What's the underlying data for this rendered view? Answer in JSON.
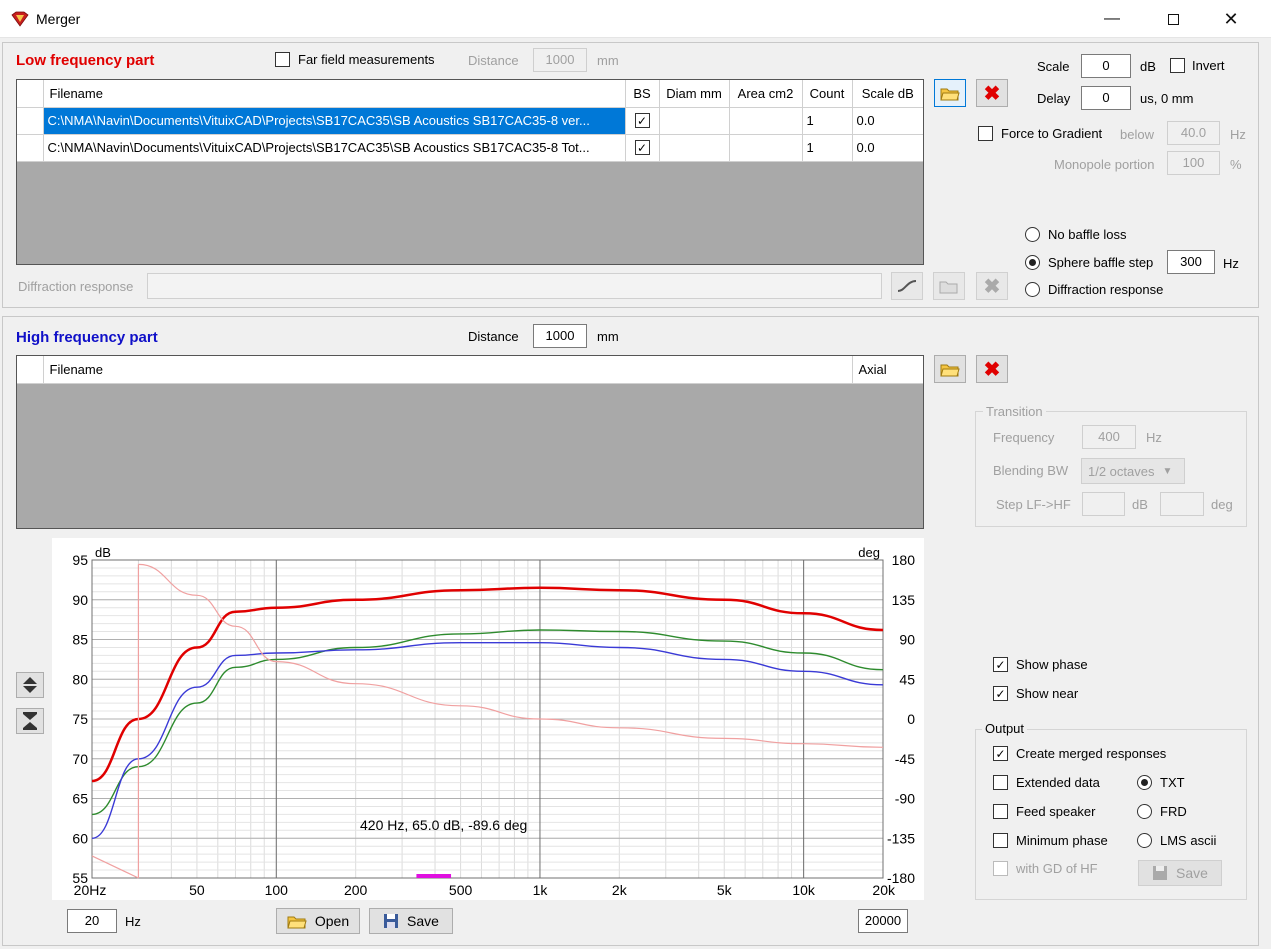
{
  "window": {
    "title": "Merger"
  },
  "lf": {
    "title": "Low frequency part",
    "far_field_label": "Far field measurements",
    "far_field_checked": false,
    "distance_label": "Distance",
    "distance_value": "1000",
    "distance_unit": "mm",
    "columns": [
      "Filename",
      "BS",
      "Diam mm",
      "Area cm2",
      "Count",
      "Scale dB"
    ],
    "rows": [
      {
        "filename": "C:\\NMA\\Navin\\Documents\\VituixCAD\\Projects\\SB17CAC35\\SB Acoustics SB17CAC35-8 ver...",
        "bs": true,
        "diam": "",
        "area": "",
        "count": "1",
        "scale": "0.0"
      },
      {
        "filename": "C:\\NMA\\Navin\\Documents\\VituixCAD\\Projects\\SB17CAC35\\SB Acoustics SB17CAC35-8 Tot...",
        "bs": true,
        "diam": "",
        "area": "",
        "count": "1",
        "scale": "0.0"
      }
    ],
    "diffraction_label": "Diffraction response",
    "scale_label": "Scale",
    "scale_value": "0",
    "scale_unit": "dB",
    "invert_label": "Invert",
    "delay_label": "Delay",
    "delay_value": "0",
    "delay_unit": "us,  0 mm",
    "force_gradient_label": "Force to Gradient",
    "below_label": "below",
    "below_value": "40.0",
    "below_unit": "Hz",
    "monopole_label": "Monopole portion",
    "monopole_value": "100",
    "monopole_unit": "%",
    "baffle_options": [
      "No baffle loss",
      "Sphere baffle step",
      "Diffraction response"
    ],
    "baffle_selected": 1,
    "baffle_value": "300",
    "baffle_unit": "Hz"
  },
  "hf": {
    "title": "High frequency part",
    "distance_label": "Distance",
    "distance_value": "1000",
    "distance_unit": "mm",
    "columns": [
      "Filename",
      "Axial"
    ],
    "transition": {
      "title": "Transition",
      "frequency_label": "Frequency",
      "frequency_value": "400",
      "frequency_unit": "Hz",
      "bw_label": "Blending BW",
      "bw_value": "1/2 octaves",
      "step_label": "Step LF->HF",
      "db_unit": "dB",
      "deg_unit": "deg"
    }
  },
  "chart_data": {
    "type": "line",
    "ylabel_left": "dB",
    "ylabel_right": "deg",
    "x_scale": "log",
    "xlim": [
      20,
      20000
    ],
    "ylim_left": [
      55,
      95
    ],
    "ylim_right": [
      -180,
      180
    ],
    "x_tick_labels": [
      "20Hz",
      "50",
      "100",
      "200",
      "500",
      "1k",
      "2k",
      "5k",
      "10k",
      "20k"
    ],
    "x_tick_values": [
      20,
      50,
      100,
      200,
      500,
      1000,
      2000,
      5000,
      10000,
      20000
    ],
    "y_ticks_left": [
      95,
      90,
      85,
      80,
      75,
      70,
      65,
      60,
      55
    ],
    "y_ticks_right": [
      180,
      135,
      90,
      45,
      0,
      -45,
      -90,
      -135,
      -180
    ],
    "grid": true,
    "cursor_readout": "420 Hz, 65.0 dB, -89.6 deg",
    "series": [
      {
        "color": "#e00000",
        "axis": "left",
        "x": [
          20,
          30,
          50,
          70,
          100,
          200,
          500,
          1000,
          2000,
          5000,
          10000,
          20000
        ],
        "y": [
          67.2,
          75,
          84,
          88.5,
          89,
          90,
          91.2,
          91.5,
          91.2,
          90,
          88.3,
          86.2
        ]
      },
      {
        "color": "#2e8b2e",
        "axis": "left",
        "x": [
          20,
          30,
          50,
          70,
          100,
          200,
          500,
          1000,
          2000,
          5000,
          10000,
          20000
        ],
        "y": [
          63,
          69,
          77,
          81.5,
          82.5,
          84,
          85.7,
          86.2,
          86,
          84.8,
          83.3,
          81.2
        ]
      },
      {
        "color": "#3a3ad6",
        "axis": "left",
        "x": [
          20,
          30,
          50,
          70,
          100,
          200,
          500,
          1000,
          2000,
          5000,
          10000,
          20000
        ],
        "y": [
          60,
          70,
          79,
          83,
          83.3,
          83.7,
          84.6,
          84.6,
          84,
          82.5,
          81,
          79.3
        ]
      },
      {
        "color": "#f0a0a0",
        "axis": "right",
        "x": [
          30,
          50,
          70,
          100,
          200,
          500,
          1000,
          2000,
          5000,
          10000,
          20000
        ],
        "y": [
          175,
          140,
          105,
          65,
          40,
          15,
          0,
          -10,
          -22,
          -28,
          -32
        ]
      }
    ],
    "near_phase_stub": {
      "color": "#f0a0a0",
      "x": [
        20,
        30
      ],
      "y": [
        -155,
        -180
      ]
    }
  },
  "chart_controls": {
    "min_value": "20",
    "min_unit": "Hz",
    "max_value": "20000",
    "open_label": "Open",
    "save_label": "Save"
  },
  "options": {
    "show_phase": "Show phase",
    "show_near": "Show near",
    "output_title": "Output",
    "create_merged": "Create merged responses",
    "extended_data": "Extended data",
    "feed_speaker": "Feed speaker",
    "minimum_phase": "Minimum phase",
    "with_gd": "with GD of HF",
    "formats": [
      "TXT",
      "FRD",
      "LMS ascii"
    ],
    "format_selected": 0,
    "save_label": "Save"
  }
}
